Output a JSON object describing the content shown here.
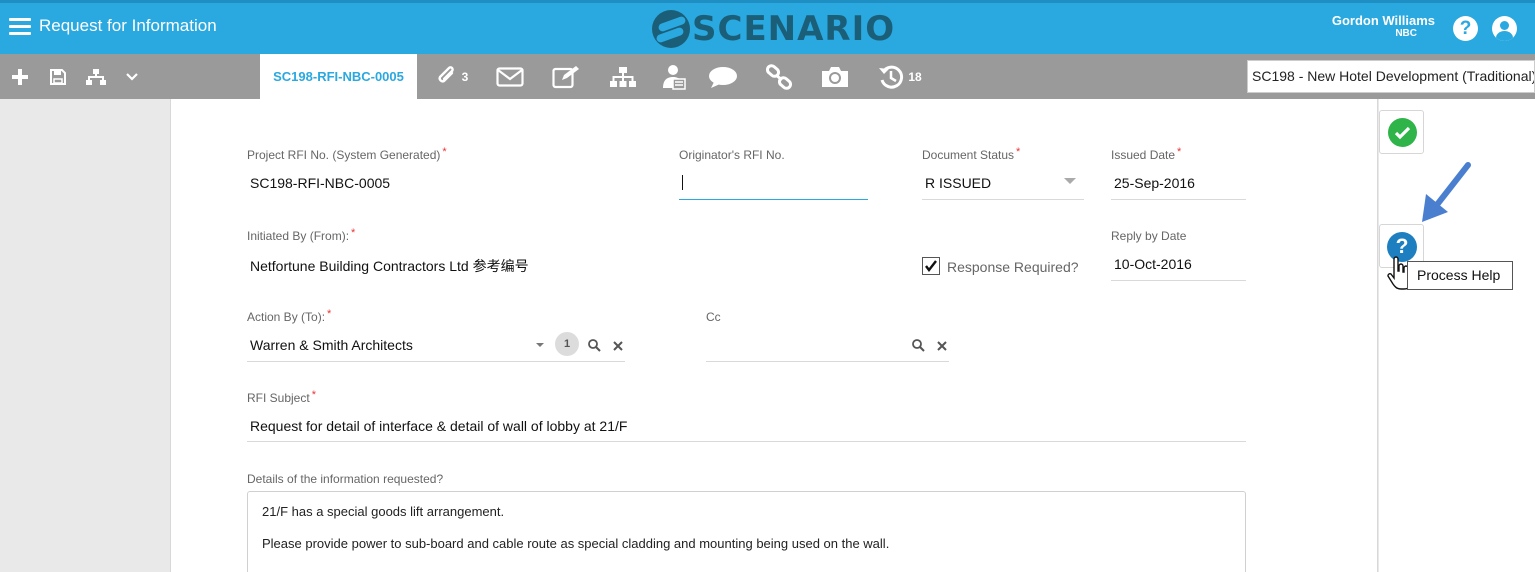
{
  "header": {
    "title": "Request for Information",
    "logo_text": "SCENARIO",
    "user_name": "Gordon Williams",
    "user_org": "NBC",
    "help_glyph": "?"
  },
  "toolbar": {
    "active_tab": "SC198-RFI-NBC-0005",
    "attachments_count": "3",
    "history_count": "18",
    "project": "SC198  -  New Hotel Development (Traditional)",
    "icons": [
      "plus-icon",
      "save-icon",
      "hierarchy-icon",
      "chevron-down-icon",
      "paperclip-icon",
      "envelope-icon",
      "edit-icon",
      "workflow-icon",
      "user-document-icon",
      "comment-icon",
      "link-icon",
      "camera-icon",
      "history-icon"
    ]
  },
  "form": {
    "project_rfi_label": "Project RFI No. (System Generated)",
    "project_rfi_value": "SC198-RFI-NBC-0005",
    "originator_label": "Originator's RFI No.",
    "originator_value": "",
    "doc_status_label": "Document Status",
    "doc_status_value": "R ISSUED",
    "issued_date_label": "Issued Date",
    "issued_date_value": "25-Sep-2016",
    "initiated_label": "Initiated By (From):",
    "initiated_value": "Netfortune Building Contractors Ltd 参考编号",
    "response_required_label": "Response Required?",
    "response_required": true,
    "reply_by_label": "Reply by Date",
    "reply_by_value": "10-Oct-2016",
    "action_by_label": "Action By (To):",
    "action_by_value": "Warren & Smith Architects",
    "action_by_count": "1",
    "cc_label": "Cc",
    "cc_value": "",
    "subject_label": "RFI Subject",
    "subject_value": "Request for detail of interface & detail of wall of lobby at 21/F",
    "details_label": "Details of the information requested?",
    "details_lines": [
      "21/F has a special goods lift arrangement.",
      "Please provide power to sub-board and cable route as special cladding and mounting being used on the wall."
    ],
    "required_mark": "*"
  },
  "side": {
    "help_glyph": "?",
    "tooltip": "Process Help"
  },
  "colors": {
    "brand": "#2aa8e0",
    "logo": "#1b5e78",
    "ok": "#2fb44a",
    "help": "#1e7fc0",
    "arrow": "#4a7fd0"
  }
}
